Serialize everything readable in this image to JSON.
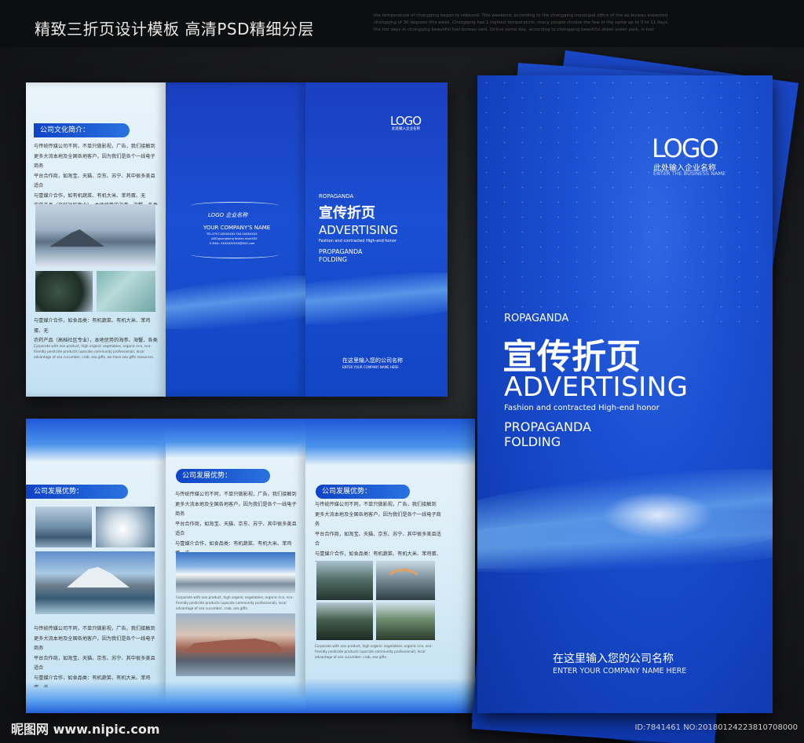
{
  "header": {
    "title": "精致三折页设计模板 高清PSD精细分层",
    "fine_print": "the temperature of chongqing began to rebound. This weekend, according to the chongqing municipal office of the ao bureau expected chongqing of 30 degrees this week. Chongqing has 1 highest temperature, many people choose the few in the same up to 3 to 11 days, the hot days in chongqing beautiful fuel bureau said. Online same day, according to chongqing beautiful sheet water park, is fool"
  },
  "sheet1": {
    "left_panel": {
      "section_title": "公司文化简介：",
      "paragraph1": "与传统传媒公司不同，不单只做影视，广告，我们接触到\n更多大流本地及全国各地客户，因为我们是各个一线电子商务\n平台合作商，如淘宝、天猫、京东、苏宁、其中很多美且适合\n与壹媒介合作，如有机蔬菜、有机大米、苯鸡蛋、无\n农药产品（高档社区专业），本地优势的海参、海蟹、各类送\n礼海产品，我们拥有海参番子人脉的资源。",
      "paragraph2": "与壹媒介合作，如食品类：有机蔬菜、有机大米、苯鸡蛋、无\n农药产品（高档社区专业），本地优势的海参、海蟹、各类送\n礼海产品，我们拥有海参番子人脉的资源。",
      "fine": "Corporate with non product, high organic vegetables, organic rice, eco-friendly pesticide products (upscale community professional), local advantage of sea cucumber, crab, sea gifts, we have sea gifts resources."
    },
    "middle_panel": {
      "logo": "LOGO 企业名称",
      "company": "YOUR COMPANY'S NAME",
      "tel": "TEL:0757-XXXXXXXX   FAX:XXXXXXXX",
      "add": "ADD:guangdong foshan shunXXX",
      "email": "E-MAIL: XXXXXXXXXX@XXX.com"
    },
    "right_panel": {
      "logo": "LOGO",
      "logo_sub": "此处输入企业名称",
      "ropaganda": "ROPAGANDA",
      "title_cn": "宣传折页",
      "title_en": "ADVERTISING",
      "tagline": "Fashion and contracted High-end honor",
      "propaganda": "PROPAGANDA",
      "folding": "FOLDING",
      "company_cn": "在这里输入您的公司名称",
      "company_en": "ENTER YOUR COMPANY NAME HERE"
    }
  },
  "sheet2": {
    "panel1": {
      "section_title": "公司发展优势：",
      "paragraph": "与传统传媒公司不同，不单只做影视，广告，我们接触到\n更多大流本地及全国各地客户，因为我们是各个一线电子商务\n平台合作商，如淘宝、天猫、京东、苏宁、其中很多美且适合\n与壹媒介合作，如食品类：有机蔬菜、有机大米、苯鸡蛋、无\n农药产品（高档社区专业），本地优势的海参、海蟹、各类送\n礼海产品，我们拥有海参番子人脉的资源。"
    },
    "panel2": {
      "section_title": "公司发展优势：",
      "paragraph": "与传统传媒公司不同，不单只做影视，广告，我们接触到\n更多大流本地及全国各地客户，因为我们是各个一线电子商务\n平台合作商，如淘宝、天猫、京东、苏宁、其中很多美且适合\n与壹媒介合作，如食品类：有机蔬菜、有机大米、苯鸡蛋、无\n农药产品（高档社区专业），本地优势的海参、海蟹、各类送\n礼海产品，我们拥有海参番子人脉的资源。",
      "fine1": "Corporate with non product, high organic vegetables, organic rice, eco-friendly pesticide products (upscale community professional), local advantage of sea cucumber, crab, sea gifts.",
      "fine2": "Corporate with non product, high organic vegetables, organic rice, eco-friendly pesticide products (upscale community professional), local advantage of sea cucumber, crab, sea gifts."
    },
    "panel3": {
      "section_title": "公司发展优势：",
      "paragraph": "与传统传媒公司不同，不单只做影视，广告，我们接触到\n更多大流本地及全国各地客户，因为我们是各个一线电子商务\n平台合作商，如淘宝、天猫、京东、苏宁、其中很多美且适合\n与壹媒介合作，如食品类：有机蔬菜、有机大米、苯鸡蛋、无\n农药产品（高档社区专业），本地优势的海参、海蟹、各类送\n礼海产品，我们拥有海参番子人脉的资源。",
      "fine": "Corporate with non product, high organic vegetables, organic rice, eco-friendly pesticide products (upscale community professional), local advantage of sea cucumber, crab, sea gifts."
    }
  },
  "cover": {
    "logo": "LOGO",
    "logo_cn": "此处输入企业名称",
    "logo_en": "ENTER THE BUSINESS NAME",
    "ropaganda": "ROPAGANDA",
    "title_cn": "宣传折页",
    "title_en": "ADVERTISING",
    "tagline": "Fashion and contracted High-end honor",
    "propaganda": "PROPAGANDA",
    "folding": "FOLDING",
    "company_cn": "在这里输入您的公司名称",
    "company_en": "ENTER YOUR COMPANY NAME HERE"
  },
  "footer": {
    "site": "昵图网 www.nipic.com",
    "id": "ID:7841461 NO:20180124223810708000"
  },
  "colors": {
    "brand_blue": "#1a4fd0",
    "pill_blue": "#0e43c5",
    "background": "#0d0e10"
  }
}
